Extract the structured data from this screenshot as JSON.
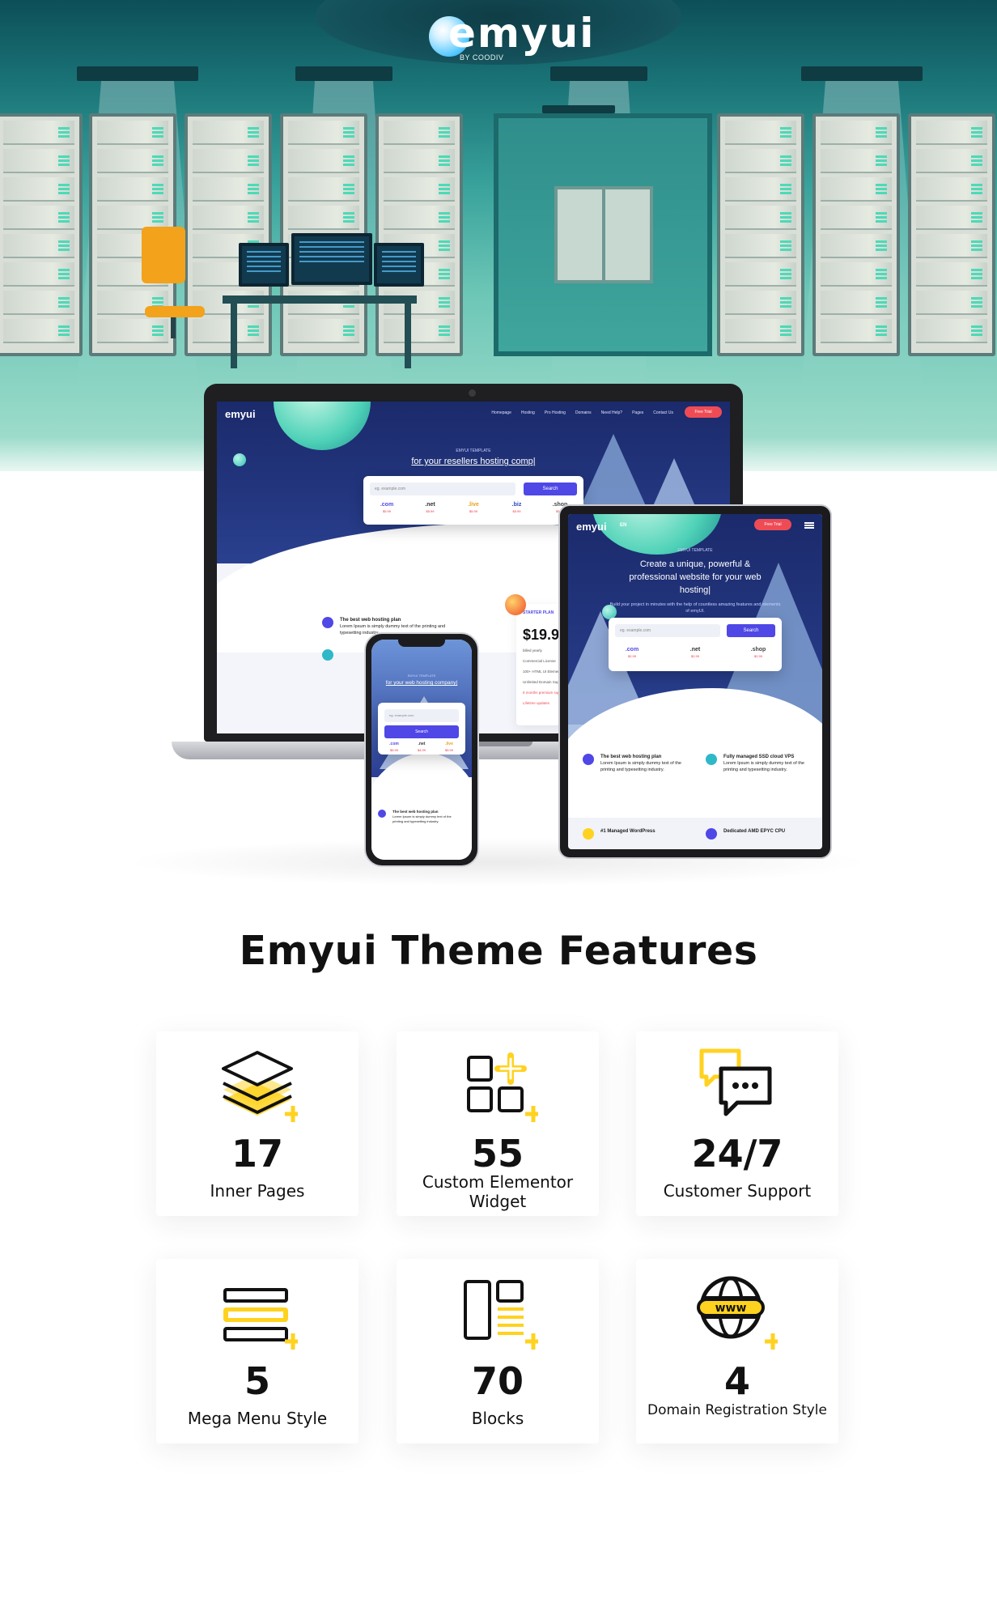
{
  "brand": {
    "logo_text": "emyui",
    "logo_sub": "BY COODIV",
    "accent": "#ffd21f",
    "primary": "#4f47e6",
    "danger": "#ef4b55"
  },
  "laptop_site": {
    "logo": "emyui",
    "nav": [
      "Homepage",
      "Hosting",
      "Pro Hosting",
      "Domains",
      "Need Help?",
      "Pages",
      "Contact Us"
    ],
    "cta": "Free Trial",
    "kicker": "EMYUI TEMPLATE",
    "headline": "for your resellers hosting comp|",
    "search_placeholder": "eg. example.com",
    "search_button": "Search",
    "tlds": [
      {
        "name": ".com",
        "price": "$5.99"
      },
      {
        "name": ".net",
        "price": "$5.99"
      },
      {
        "name": ".live",
        "price": "$5.99"
      },
      {
        "name": ".biz",
        "price": "$5.99"
      },
      {
        "name": ".shop",
        "price": "$5.99"
      }
    ],
    "feature_title": "The best web hosting plan",
    "feature_text": "Lorem Ipsum is simply dummy text of the printing and typesetting industry.",
    "plan": {
      "label": "STARTER PLAN",
      "price": "$19.99",
      "billing": "billed yearly",
      "items": [
        "Commercial License",
        "100+ HTML UI Elements",
        "Unlimited Domain Support",
        "6 months premium support",
        "Lifetime updates"
      ]
    }
  },
  "tablet_site": {
    "logo": "emyui",
    "lang": "EN",
    "cta": "Free Trial",
    "kicker": "EMYUI TEMPLATE",
    "headline": "Create a unique, powerful & professional website for your web hosting|",
    "sub": "Build your project in minutes with the help of countless amazing features and elements of emyUI.",
    "search_placeholder": "eg. example.com",
    "search_button": "Search",
    "tlds": [
      {
        "name": ".com",
        "price": "$2.99"
      },
      {
        "name": ".net",
        "price": "$2.99"
      },
      {
        "name": ".shop",
        "price": "$2.99"
      }
    ],
    "features": [
      {
        "title": "The best web hosting plan",
        "text": "Lorem Ipsum is simply dummy text of the printing and typesetting industry."
      },
      {
        "title": "Fully managed SSD cloud VPS",
        "text": "Lorem Ipsum is simply dummy text of the printing and typesetting industry."
      },
      {
        "title": "#1 Managed WordPress",
        "text": ""
      },
      {
        "title": "Dedicated AMD EPYC CPU",
        "text": ""
      }
    ]
  },
  "phone_site": {
    "kicker": "EMYUI TEMPLATE",
    "headline": "for your web hosting company|",
    "search_placeholder": "eg. example.com",
    "search_button": "Search",
    "tlds": [
      {
        "name": ".com",
        "price": "$5.99"
      },
      {
        "name": ".net",
        "price": "$4.99"
      },
      {
        "name": ".live",
        "price": "$5.99"
      }
    ],
    "feature_title": "The best web hosting plan",
    "feature_text": "Lorem Ipsum is simply dummy text of the printing and typesetting industry."
  },
  "features_section": {
    "title": "Emyui Theme Features",
    "cards": [
      {
        "icon": "layers-icon",
        "number": "17",
        "label": "Inner Pages"
      },
      {
        "icon": "widgets-icon",
        "number": "55",
        "label": "Custom Elementor Widget"
      },
      {
        "icon": "chat-icon",
        "number": "24/7",
        "label": "Customer Support"
      },
      {
        "icon": "menu-icon",
        "number": "5",
        "label": "Mega Menu Style"
      },
      {
        "icon": "blocks-icon",
        "number": "70",
        "label": "Blocks"
      },
      {
        "icon": "www-icon",
        "number": "4",
        "label": "Domain Registration Style"
      }
    ]
  }
}
